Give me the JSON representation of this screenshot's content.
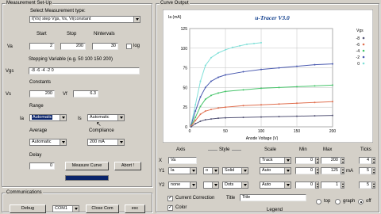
{
  "measurement": {
    "title": "Measurement Set-Up",
    "type_label": "Select Measurement type:",
    "type_value": "I(Vs) step Vgs, Vs, Vi(constant",
    "col_start": "Start",
    "col_stop": "Stop",
    "col_nintervals": "Nintervals",
    "va_label": "Va",
    "va_start": "2",
    "va_stop": "200",
    "va_nint": "30",
    "log_label": "log",
    "stepping_label": "Stepping Variable (e.g. 50 100 150 200)",
    "vgs_label": "Vgs",
    "vgs_value": "-8 -6 -4 -2 0",
    "constants_label": "Constants",
    "vs_label": "Vs",
    "vs_value": "200",
    "vf_label": "Vf",
    "vf_value": "6.3",
    "range_label": "Range",
    "ia_label": "Ia",
    "ia_range": "Automatic",
    "is_label": "Is",
    "is_range": "Automatic",
    "average_label": "Average",
    "average_value": "Automatic",
    "compliance_label": "Compliance",
    "compliance_value": "200 mA",
    "delay_label": "Delay",
    "delay_value": "0",
    "measure_button": "Measure Curve",
    "abort_button": "Abort !",
    "progress": 1.0
  },
  "communications": {
    "title": "Communications",
    "debug_button": "Debug",
    "port_value": "COM1",
    "close_button": "Close Com",
    "esc_button": "esc"
  },
  "curve_output": {
    "title": "Curve Output",
    "axes_header": "Axis",
    "style_header": "Style",
    "scale_header": "Scale",
    "min_header": "Min",
    "max_header": "Max",
    "ticks_header": "Ticks",
    "rows": [
      {
        "axis": "X",
        "var": "Va",
        "marker": "",
        "line": "",
        "scale": "Track",
        "min": "0",
        "max": "200",
        "unit": "",
        "ticks": "4"
      },
      {
        "axis": "Y1",
        "var": "Ia",
        "marker": "o",
        "line": "Solid",
        "scale": "Auto",
        "min": "0",
        "max": "125",
        "unit": "mA",
        "ticks": "5"
      },
      {
        "axis": "Y2",
        "var": "none",
        "marker": "",
        "line": "Dots",
        "scale": "Auto",
        "min": "0",
        "max": "1",
        "unit": "",
        "ticks": "5"
      }
    ],
    "current_correction_label": "Current Correction",
    "color_label": "Color",
    "title_label": "Title",
    "title_value": "Title",
    "legend_label": "Legend",
    "legend_options": [
      "top",
      "graph",
      "off"
    ],
    "legend_selected": "off"
  },
  "chart_data": {
    "type": "line",
    "title": "u-Tracer V3.0",
    "xlabel": "Anode Voltage (V)",
    "ylabel": "Ia (mA)",
    "xlim": [
      0,
      200
    ],
    "ylim": [
      0,
      125
    ],
    "xticks": [
      0,
      50,
      100,
      150,
      200
    ],
    "yticks": [
      0,
      25,
      50,
      75,
      100,
      125
    ],
    "legend_title": "Vgs",
    "series": [
      {
        "name": "0",
        "color": "#7fe0d8",
        "x": [
          2,
          8,
          15,
          22,
          30,
          40,
          50,
          60,
          70,
          80,
          90,
          100
        ],
        "y": [
          3,
          28,
          58,
          78,
          88,
          94,
          98,
          101,
          103,
          105,
          106,
          107
        ]
      },
      {
        "name": "-2",
        "color": "#4a5ab0",
        "x": [
          2,
          8,
          15,
          22,
          30,
          40,
          50,
          75,
          100,
          125,
          150,
          175,
          200
        ],
        "y": [
          2,
          20,
          38,
          50,
          58,
          63,
          66,
          70,
          73,
          75,
          77,
          79,
          80
        ]
      },
      {
        "name": "-4",
        "color": "#46c46a",
        "x": [
          2,
          8,
          15,
          22,
          30,
          40,
          50,
          75,
          100,
          125,
          150,
          175,
          200
        ],
        "y": [
          1,
          12,
          26,
          35,
          40,
          43,
          45,
          47,
          49,
          50,
          51,
          52,
          53
        ]
      },
      {
        "name": "-6",
        "color": "#e07050",
        "x": [
          2,
          8,
          15,
          22,
          30,
          40,
          50,
          75,
          100,
          125,
          150,
          175,
          200
        ],
        "y": [
          1,
          8,
          16,
          20,
          22,
          24,
          25,
          27,
          28,
          29,
          30,
          31,
          32
        ]
      },
      {
        "name": "-8",
        "color": "#555577",
        "x": [
          2,
          8,
          15,
          22,
          30,
          40,
          50,
          75,
          100,
          125,
          150,
          175,
          200
        ],
        "y": [
          0,
          4,
          7,
          9,
          10,
          11,
          11.5,
          12,
          12.5,
          13,
          13.5,
          14,
          14.5
        ]
      }
    ],
    "grid": true
  }
}
